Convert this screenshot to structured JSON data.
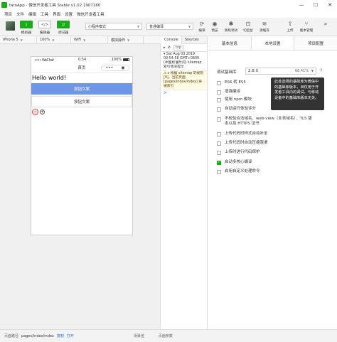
{
  "window": {
    "title": "taroApp - 微信开发者工具 Stable v1.02.1907160",
    "controls": [
      "—",
      "☐",
      "✕"
    ]
  },
  "menu": [
    "项目",
    "文件",
    "编辑",
    "工具",
    "界面",
    "设置",
    "微信开发者工具"
  ],
  "toolbar": {
    "simulator_label": "模拟器",
    "editor_label": "编辑器",
    "debugger_label": "调试器",
    "mode_select": "小程序模式",
    "compile_select": "普通编译",
    "compile_label": "编译",
    "preview_label": "预览",
    "remote_debug_label": "真机调试",
    "cut_backend_label": "切后台",
    "clear_cache_label": "清缓存",
    "upload_label": "上传",
    "version_label": "版本管理",
    "more": "»"
  },
  "simulator": {
    "device": "iPhone 5",
    "zoom": "100%",
    "network": "WiFi",
    "operation": "模拟操作",
    "status_carrier": "•••• WeChat",
    "status_time": "0:54",
    "status_battery": "100%",
    "nav_title": "首页",
    "capsule_dots": "•••",
    "capsule_target": "◉",
    "hello_text": "Hello world!",
    "primary_button": "按钮文案",
    "default_button": "按钮文案"
  },
  "devtools": {
    "tabs": [
      "Console",
      "Sources"
    ],
    "filter_context": "top",
    "logs": [
      {
        "text": "▾ Sat Aug 03 2019 00:54:58 GMT+0800 (中国标准时间) sitemap 索引情况提示",
        "warn": false
      },
      {
        "text": "⚠ ▸ 根据 sitemap 的规则[0]，当前页面 [pages/index/index] 将被索引",
        "warn": true
      }
    ],
    "prompt": ">"
  },
  "details": {
    "tabs": [
      "基本信息",
      "本地设置",
      "项目配置"
    ],
    "active_tab": 1,
    "base_lib_label": "调试基础库",
    "base_lib_version": "2.8.0",
    "base_lib_percent": "68.41%",
    "help": "?",
    "tooltip": "此处选择的基础库为微信中的基础库版本，目仅用于开发者工具内的调试，与移动设备中的基础库版本无关。",
    "options": [
      {
        "label": "ES6 转 ES5",
        "checked": false
      },
      {
        "label": "增强编译",
        "checked": false
      },
      {
        "label": "使用 npm 模块",
        "checked": false
      },
      {
        "label": "自动运行体验评分",
        "checked": false
      },
      {
        "label": "不校验合法域名、web-view（业务域名）、TLS 版本以及 HTTPS 证书",
        "checked": false
      },
      {
        "label": "上传代码时样式自动补全",
        "checked": false
      },
      {
        "label": "上传代码时自动压缩混淆",
        "checked": false
      },
      {
        "label": "上传时进行代码保护",
        "checked": false
      },
      {
        "label": "启动多核心编译",
        "checked": true
      },
      {
        "label": "启用自定义处理命令",
        "checked": false
      }
    ]
  },
  "footer": {
    "path_label": "页面路径",
    "path": "pages/index/index",
    "copy": "复制",
    "open": "打开",
    "scene": "场景值",
    "params": "页面参数"
  },
  "colors": {
    "brand_green": "#1aad19",
    "primary_blue": "#6f96e6",
    "tooltip_bg": "#333333"
  }
}
